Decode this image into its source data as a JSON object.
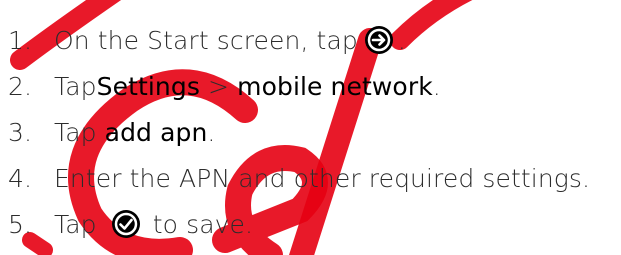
{
  "steps": [
    {
      "number": "1.",
      "before": "On the Start screen, tap ",
      "icon": "arrow-right-circle-icon",
      "after": "."
    },
    {
      "number": "2.",
      "before": "Tap ",
      "term1": "Settings",
      "middle": " > ",
      "term2": "mobile network",
      "after": "."
    },
    {
      "number": "3.",
      "before": "Tap ",
      "term1": "add apn",
      "after": "."
    },
    {
      "number": "4.",
      "text": "Enter the APN and other required settings."
    },
    {
      "number": "5.",
      "before": "Tap ",
      "icon": "checkmark-circle-icon",
      "after": " to save."
    }
  ],
  "watermark": {
    "text": "Cel",
    "color": "#e60012"
  },
  "colors": {
    "text": "#2c2c2c",
    "term": "#000000",
    "watermark": "#e60012"
  }
}
